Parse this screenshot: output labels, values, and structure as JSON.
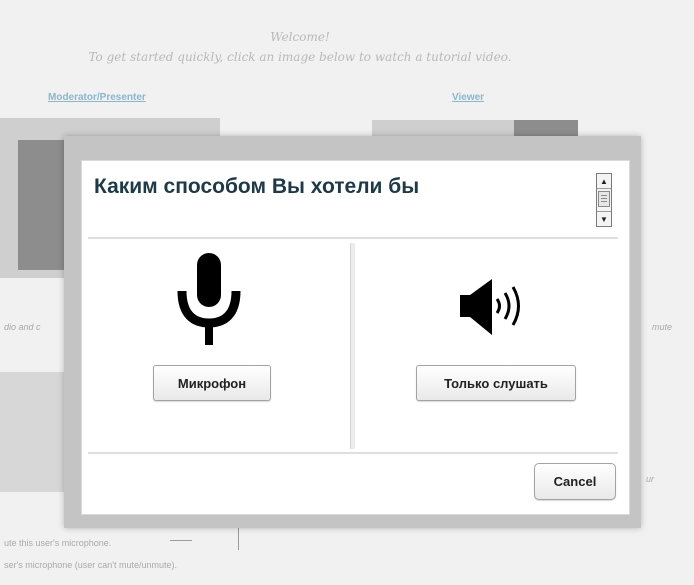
{
  "background": {
    "welcome_title": "Welcome!",
    "welcome_subtitle": "To get started quickly, click an image below to watch a tutorial video.",
    "moderator_link": "Moderator/Presenter",
    "viewer_link": "Viewer",
    "side_text_left": "dio and c",
    "side_text_right": "mute",
    "side_text_right2": "ur",
    "bottom_text_1": "ute this user's microphone.",
    "bottom_text_2": "ser's microphone (user can't mute/unmute)."
  },
  "dialog": {
    "title": "Каким способом Вы хотели бы",
    "microphone_button": "Микрофон",
    "listen_only_button": "Только слушать",
    "cancel_button": "Cancel"
  },
  "icons": {
    "microphone": "microphone-icon",
    "speaker": "speaker-icon",
    "scroll_up": "▲",
    "scroll_down": "▼"
  },
  "colors": {
    "title": "#1f3a46",
    "overlay": "#c4c4c4",
    "link": "#8bb7cc"
  }
}
